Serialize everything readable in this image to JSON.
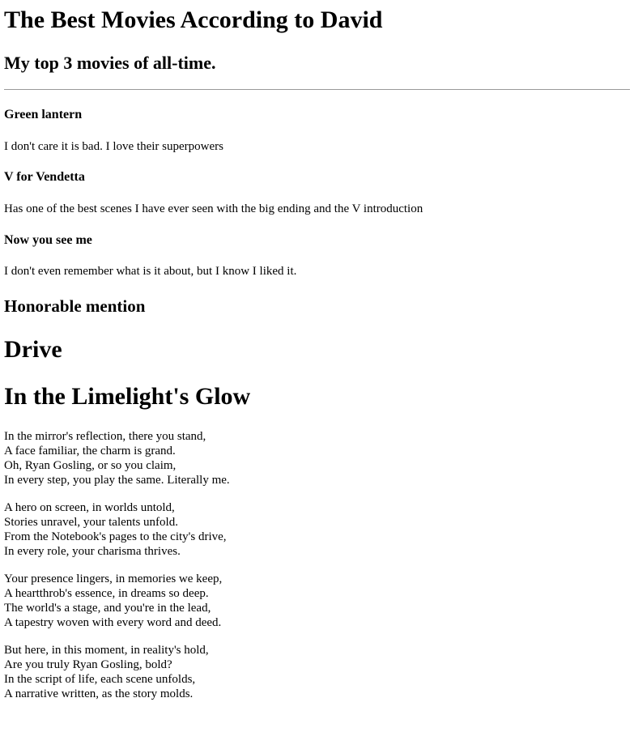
{
  "title": "The Best Movies According to David",
  "subtitle": "My top 3 movies of all-time.",
  "movies": [
    {
      "name": "Green lantern",
      "comment": "I don't care it is bad. I love their superpowers"
    },
    {
      "name": "V for Vendetta",
      "comment": "Has one of the best scenes I have ever seen with the big ending and the V introduction"
    },
    {
      "name": "Now you see me",
      "comment": "I don't even remember what is it about, but I know I liked it."
    }
  ],
  "honorable_heading": "Honorable mention",
  "honorable_movie": "Drive",
  "poem": {
    "title": "In the Limelight's Glow",
    "stanzas": [
      [
        "In the mirror's reflection, there you stand,",
        "A face familiar, the charm is grand.",
        "Oh, Ryan Gosling, or so you claim,",
        "In every step, you play the same. Literally me."
      ],
      [
        "A hero on screen, in worlds untold,",
        "Stories unravel, your talents unfold.",
        "From the Notebook's pages to the city's drive,",
        "In every role, your charisma thrives."
      ],
      [
        "Your presence lingers, in memories we keep,",
        "A heartthrob's essence, in dreams so deep.",
        "The world's a stage, and you're in the lead,",
        "A tapestry woven with every word and deed."
      ],
      [
        "But here, in this moment, in reality's hold,",
        "Are you truly Ryan Gosling, bold?",
        "In the script of life, each scene unfolds,",
        "A narrative written, as the story molds."
      ]
    ]
  }
}
